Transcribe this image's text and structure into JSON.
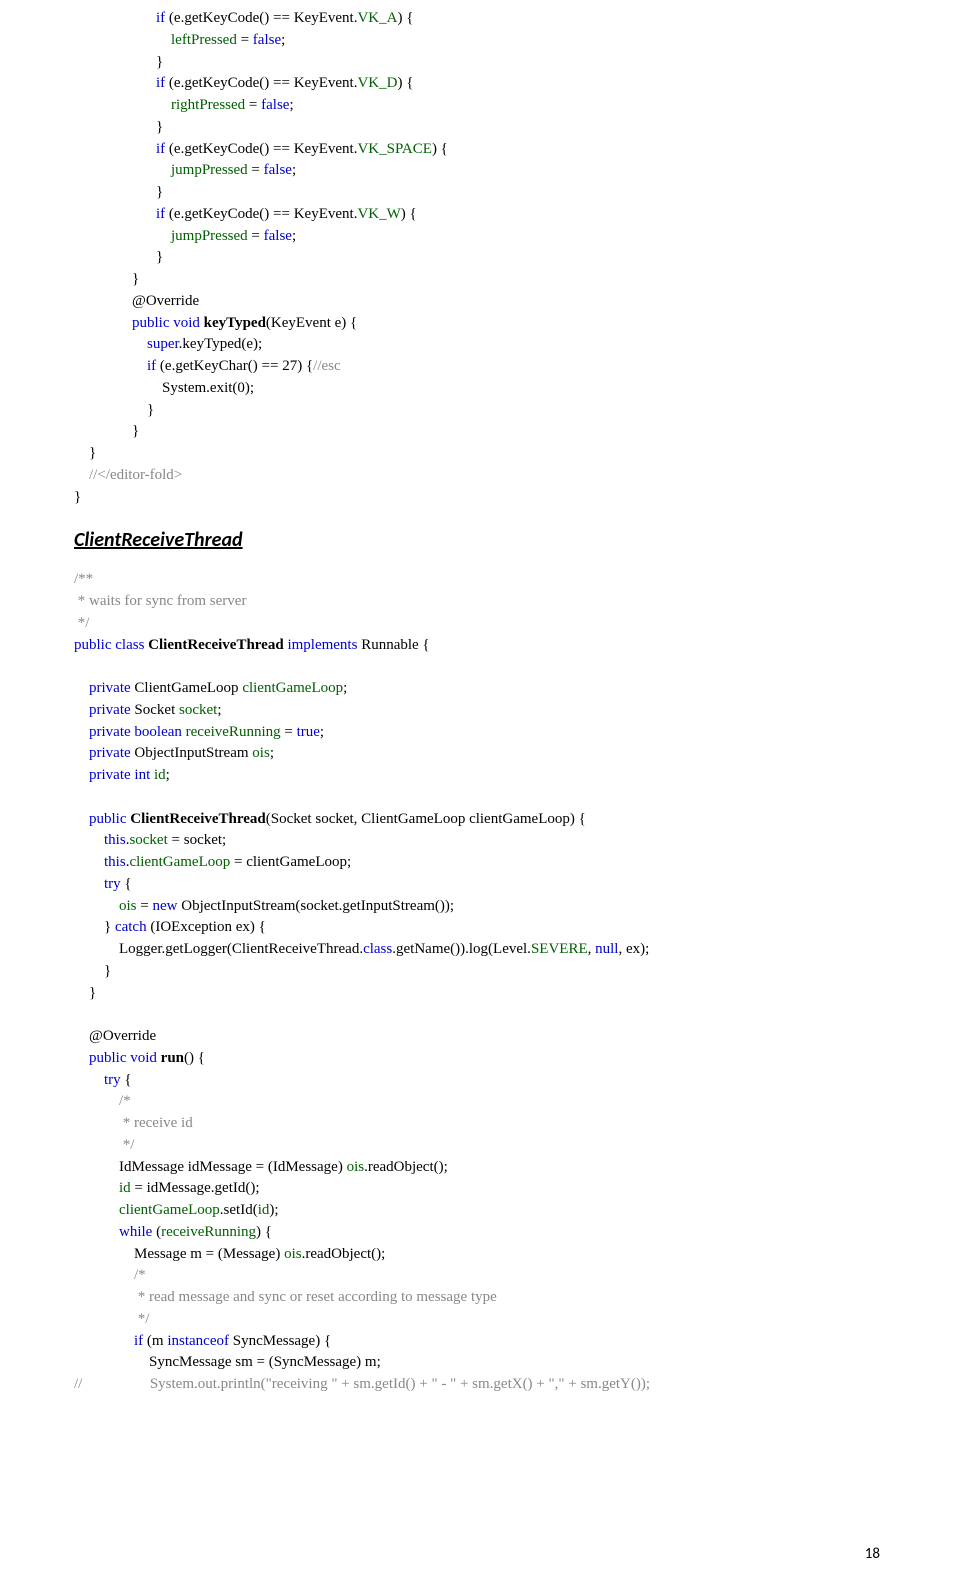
{
  "block1": [
    "<span class='kw'>if</span> (e.getKeyCode() == KeyEvent.<span class='fld'>VK_A</span>) {",
    "    <span class='fld'>leftPressed</span> = <span class='kw'>false</span>;",
    "}",
    "<span class='kw'>if</span> (e.getKeyCode() == KeyEvent.<span class='fld'>VK_D</span>) {",
    "    <span class='fld'>rightPressed</span> = <span class='kw'>false</span>;",
    "}",
    "<span class='kw'>if</span> (e.getKeyCode() == KeyEvent.<span class='fld'>VK_SPACE</span>) {",
    "    <span class='fld'>jumpPressed</span> = <span class='kw'>false</span>;",
    "}",
    "<span class='kw'>if</span> (e.getKeyCode() == KeyEvent.<span class='fld'>VK_W</span>) {",
    "    <span class='fld'>jumpPressed</span> = <span class='kw'>false</span>;",
    "}"
  ],
  "block1b": [
    "}",
    "@Override",
    "<span class='kw'>public void</span> <b>keyTyped</b>(KeyEvent e) {",
    "    <span class='kw'>super</span>.keyTyped(e);",
    "    <span class='kw'>if</span> (e.getKeyChar() == 27) {<span class='cmt'>//esc</span>",
    "        System.exit(0);",
    "    }",
    "}"
  ],
  "block1c": [
    "    }",
    "    <span class='cmt'>//&lt;/editor-fold&gt;</span>",
    "}"
  ],
  "heading": "ClientReceiveThread",
  "block2": [
    "<span class='cmt'>/**</span>",
    "<span class='cmt'> * waits for sync from server</span>",
    "<span class='cmt'> */</span>",
    "<span class='kw'>public class</span> <b>ClientReceiveThread</b> <span class='kw'>implements</span> Runnable {",
    "",
    "    <span class='kw'>private</span> ClientGameLoop <span class='fld'>clientGameLoop</span>;",
    "    <span class='kw'>private</span> Socket <span class='fld'>socket</span>;",
    "    <span class='kw'>private boolean</span> <span class='fld'>receiveRunning</span> = <span class='kw'>true</span>;",
    "    <span class='kw'>private</span> ObjectInputStream <span class='fld'>ois</span>;",
    "    <span class='kw'>private int</span> <span class='fld'>id</span>;",
    "",
    "    <span class='kw'>public</span> <b>ClientReceiveThread</b>(Socket socket, ClientGameLoop clientGameLoop) {",
    "        <span class='kw'>this</span>.<span class='fld'>socket</span> = socket;",
    "        <span class='kw'>this</span>.<span class='fld'>clientGameLoop</span> = clientGameLoop;",
    "        <span class='kw'>try</span> {",
    "            <span class='fld'>ois</span> = <span class='kw'>new</span> ObjectInputStream(socket.getInputStream());",
    "        } <span class='kw'>catch</span> (IOException ex) {",
    "            Logger.getLogger(ClientReceiveThread.<span class='kw'>class</span>.getName()).log(Level.<span class='fld'>SEVERE</span>, <span class='kw'>null</span>, ex);",
    "        }",
    "    }",
    "",
    "    @Override",
    "    <span class='kw'>public void</span> <b>run</b>() {",
    "        <span class='kw'>try</span> {",
    "            <span class='cmt'>/*</span>",
    "            <span class='cmt'> * receive id</span>",
    "            <span class='cmt'> */</span>",
    "            IdMessage idMessage = (IdMessage) <span class='fld'>ois</span>.readObject();",
    "            <span class='fld'>id</span> = idMessage.getId();",
    "            <span class='fld'>clientGameLoop</span>.setId(<span class='fld'>id</span>);",
    "            <span class='kw'>while</span> (<span class='fld'>receiveRunning</span>) {",
    "                Message m = (Message) <span class='fld'>ois</span>.readObject();",
    "                <span class='cmt'>/*</span>",
    "                <span class='cmt'> * read message and sync or reset according to message type</span>",
    "                <span class='cmt'> */</span>",
    "                <span class='kw'>if</span> (m <span class='kw'>instanceof</span> SyncMessage) {",
    "                    SyncMessage sm = (SyncMessage) m;",
    "<span class='cmt'>//                  System.out.println(\"receiving \" + sm.getId() + \" - \" + sm.getX() + \",\" + sm.getY());</span>"
  ],
  "pagenum": "18"
}
